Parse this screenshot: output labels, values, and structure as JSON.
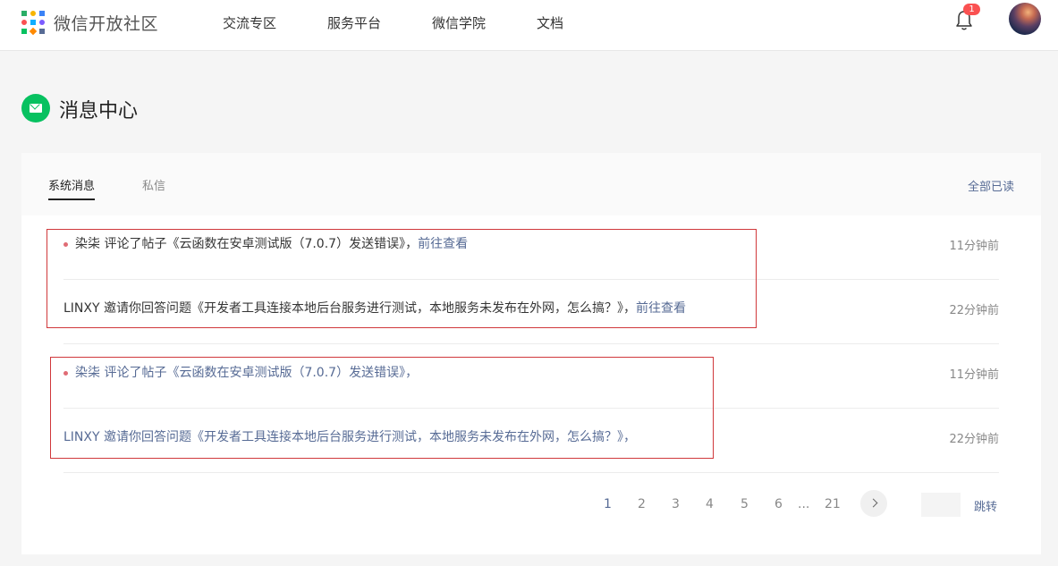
{
  "header": {
    "site_title": "微信开放社区",
    "nav": [
      "交流专区",
      "服务平台",
      "微信学院",
      "文档"
    ],
    "notification_count": "1",
    "logo_colors": [
      "#2aae67",
      "#f7b500",
      "#3b82f6",
      "#fa5151",
      "#10aeff",
      "#7c5cff",
      "#07c160",
      "#ff8a00",
      "#576b95"
    ]
  },
  "page": {
    "title": "消息中心",
    "accent_color": "#07c160"
  },
  "tabs": {
    "items": [
      "系统消息",
      "私信"
    ],
    "active": "系统消息",
    "mark_all_read": "全部已读"
  },
  "messages": [
    {
      "unread": true,
      "text": "染柒 评论了帖子《云函数在安卓测试版（7.0.7）发送错误》，",
      "link": "前往查看",
      "time": "11分钟前"
    },
    {
      "unread": false,
      "text": "LINXY 邀请你回答问题《开发者工具连接本地后台服务进行测试，本地服务未发布在外网，怎么搞？》，",
      "link": "前往查看",
      "time": "22分钟前"
    },
    {
      "unread": true,
      "text": "染柒 评论了帖子《云函数在安卓测试版（7.0.7）发送错误》，",
      "link": "",
      "time": "11分钟前"
    },
    {
      "unread": false,
      "text": "LINXY 邀请你回答问题《开发者工具连接本地后台服务进行测试，本地服务未发布在外网，怎么搞？》，",
      "link": "",
      "time": "22分钟前"
    }
  ],
  "pagination": {
    "pages": [
      "1",
      "2",
      "3",
      "4",
      "5",
      "6"
    ],
    "ellipsis": "...",
    "last": "21",
    "current": "1",
    "jump_label": "跳转",
    "jump_value": ""
  }
}
